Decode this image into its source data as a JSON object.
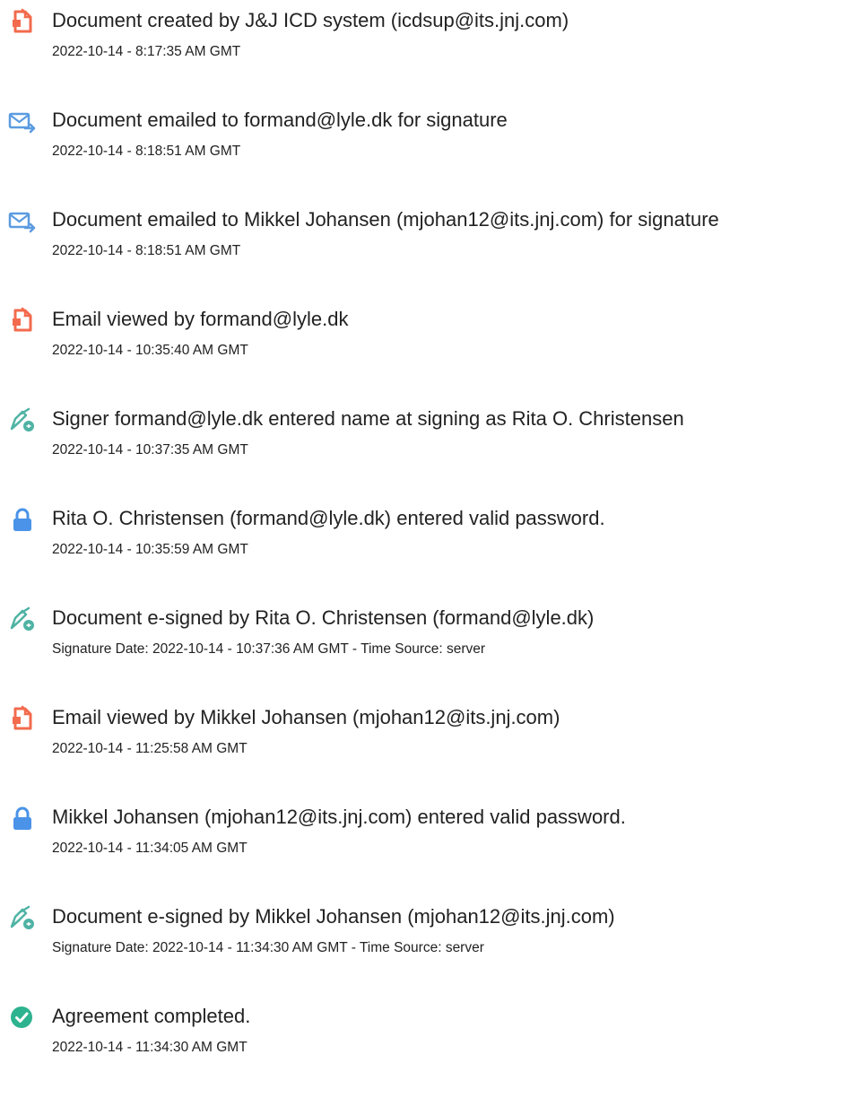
{
  "colors": {
    "document_icon": "#f26b4d",
    "email_icon": "#5b9be0",
    "signature_icon": "#4fb3a4",
    "lock_icon": "#4a93e8",
    "completed_icon": "#2db38f",
    "text": "#222222"
  },
  "events": [
    {
      "icon": "document-icon",
      "title": "Document created by J&J ICD system (icdsup@its.jnj.com)",
      "detail": "2022-10-14 - 8:17:35 AM GMT"
    },
    {
      "icon": "email-send-icon",
      "title": "Document emailed to formand@lyle.dk for signature",
      "detail": "2022-10-14 - 8:18:51 AM GMT"
    },
    {
      "icon": "email-send-icon",
      "title": "Document emailed to Mikkel Johansen (mjohan12@its.jnj.com) for signature",
      "detail": "2022-10-14 - 8:18:51 AM GMT"
    },
    {
      "icon": "document-icon",
      "title": "Email viewed by formand@lyle.dk",
      "detail": "2022-10-14 - 10:35:40 AM GMT"
    },
    {
      "icon": "signature-pen-icon",
      "title": "Signer formand@lyle.dk entered name at signing as Rita O. Christensen",
      "detail": "2022-10-14 - 10:37:35 AM GMT"
    },
    {
      "icon": "lock-icon",
      "title": "Rita O. Christensen (formand@lyle.dk) entered valid password.",
      "detail": "2022-10-14 - 10:35:59 AM GMT"
    },
    {
      "icon": "signature-pen-icon",
      "title": "Document e-signed by Rita O. Christensen (formand@lyle.dk)",
      "detail": "Signature Date: 2022-10-14 - 10:37:36 AM GMT - Time Source: server"
    },
    {
      "icon": "document-icon",
      "title": "Email viewed by Mikkel Johansen (mjohan12@its.jnj.com)",
      "detail": "2022-10-14 - 11:25:58 AM GMT"
    },
    {
      "icon": "lock-icon",
      "title": "Mikkel Johansen (mjohan12@its.jnj.com) entered valid password.",
      "detail": "2022-10-14 - 11:34:05 AM GMT"
    },
    {
      "icon": "signature-pen-icon",
      "title": "Document e-signed by Mikkel Johansen (mjohan12@its.jnj.com)",
      "detail": "Signature Date: 2022-10-14 - 11:34:30 AM GMT - Time Source: server"
    },
    {
      "icon": "checkmark-circle-icon",
      "title": "Agreement completed.",
      "detail": "2022-10-14 - 11:34:30 AM GMT"
    }
  ]
}
